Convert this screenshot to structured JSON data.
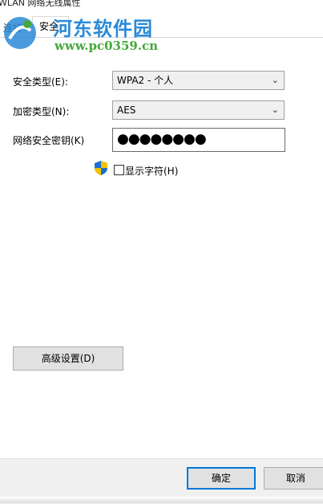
{
  "window": {
    "title": "WLAN 网络无线属性"
  },
  "watermark": {
    "site_name": "河东软件园",
    "url": "www.pc0359.cn"
  },
  "tabs": [
    {
      "label": "连接"
    },
    {
      "label": "安全",
      "selected": true
    }
  ],
  "form": {
    "security_type": {
      "label": "安全类型(E):",
      "value": "WPA2 - 个人"
    },
    "encryption_type": {
      "label": "加密类型(N):",
      "value": "AES"
    },
    "network_key": {
      "label": "网络安全密钥(K)",
      "value": "●●●●●●●●"
    },
    "show_characters": {
      "label": "显示字符(H)",
      "checked": false
    }
  },
  "buttons": {
    "advanced": "高级设置(D)",
    "ok": "确定",
    "cancel": "取消"
  },
  "colors": {
    "accent": "#0078d7",
    "watermark_blue": "#2a8ad8",
    "watermark_green": "#44a83a"
  }
}
